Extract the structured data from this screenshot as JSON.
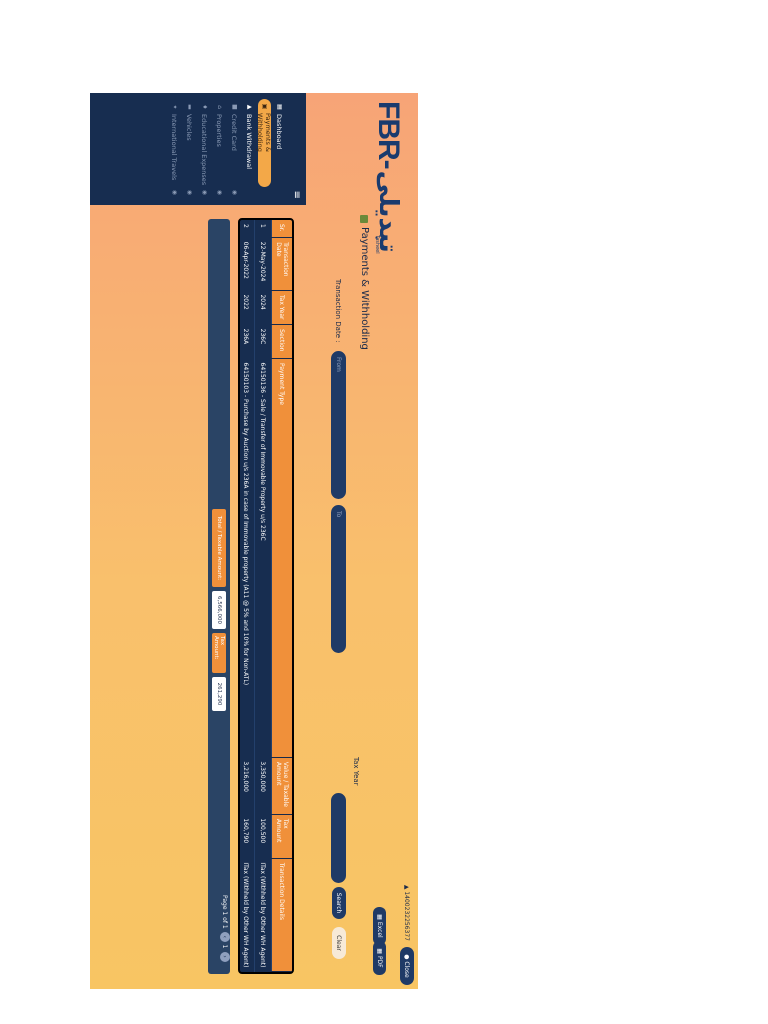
{
  "header": {
    "logo_text": "FBR-",
    "logo_urdu": "تبدیلی",
    "logo_sub": "Tasheel",
    "user_id": "1400232256377",
    "close_label": "Close"
  },
  "sidebar": {
    "items": [
      {
        "label": "Dashboard",
        "icon": "grid-icon"
      },
      {
        "label": "Payments & Withholding",
        "icon": "wallet-icon"
      },
      {
        "label": "Bank Withdrawal",
        "icon": "bank-icon"
      },
      {
        "label": "Credit Card",
        "icon": "card-icon"
      },
      {
        "label": "Properties",
        "icon": "home-icon"
      },
      {
        "label": "Educational Expenses",
        "icon": "book-icon"
      },
      {
        "label": "Vehicles",
        "icon": "car-icon"
      },
      {
        "label": "International Travels",
        "icon": "plane-icon"
      }
    ]
  },
  "page": {
    "title": "Payments & Withholding",
    "excel_label": "Excel",
    "pdf_label": "PDF"
  },
  "filters": {
    "transaction_date_label": "Transaction Date :",
    "from_placeholder": "From",
    "to_placeholder": "To",
    "tax_year_label": "Tax Year",
    "search_label": "Search",
    "clear_label": "Clear"
  },
  "table": {
    "columns": [
      "Sr.",
      "Transaction Date",
      "Tax Year",
      "Section",
      "Payment Type",
      "Value / Taxable Amount",
      "Tax Amount",
      "Transaction Details"
    ],
    "rows": [
      [
        "1",
        "22-May-2024",
        "2024",
        "236C",
        "64150136 - Sale / Transfer of Immovable Property u/s 236C",
        "3,350,000",
        "100,500",
        "ITax (Withheld by Other WH Agent)"
      ],
      [
        "2",
        "06-Apr-2022",
        "2022",
        "236A",
        "64150103 - Purchase by Auction u/s 236A in case of Immovable property (A11 @ 5% and 10% for Non-ATL)",
        "3,216,000",
        "160,790",
        "ITax (Withheld by Other WH Agent)"
      ]
    ]
  },
  "footer": {
    "total_label": "Total / Taxable Amount:",
    "total_value": "6,566,000",
    "tax_label": "Tax Amount:",
    "tax_value": "261,290",
    "page_info": "Page 1 of 1",
    "page_number": "1"
  },
  "colors": {
    "navy": "#172d50",
    "orange": "#f0903a",
    "gradient_start": "#f7a477",
    "gradient_end": "#f8c563"
  }
}
